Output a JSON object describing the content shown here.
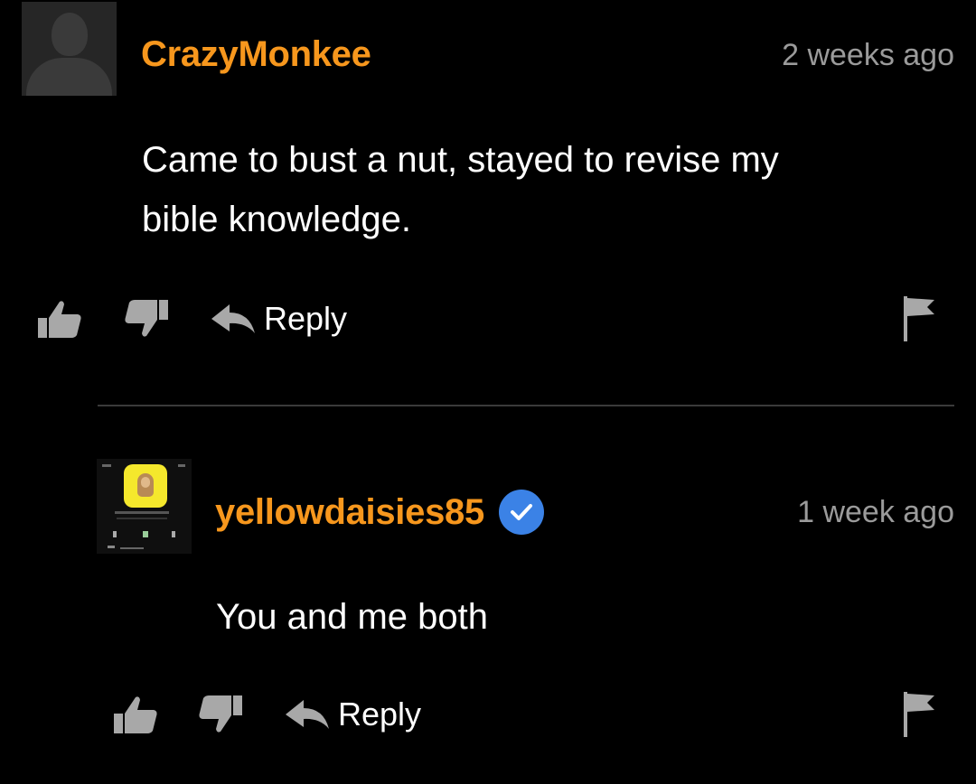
{
  "comments": [
    {
      "username": "CrazyMonkee",
      "time": "2 weeks ago",
      "text_lines": [
        "Came to bust a nut, stayed to revise my",
        "bible knowledge."
      ],
      "reply_label": "Reply",
      "avatar_icon": "default-user-icon"
    },
    {
      "username": "yellowdaisies85",
      "verified": true,
      "time": "1 week ago",
      "text_lines": [
        "You and me both"
      ],
      "reply_label": "Reply",
      "avatar_icon": "snapchat-screenshot-avatar"
    }
  ],
  "colors": {
    "background": "#000000",
    "username": "#f7971d",
    "timestamp": "#9b9b9b",
    "icon_gray": "#a8a8a8",
    "verified_blue": "#3b82e6"
  }
}
